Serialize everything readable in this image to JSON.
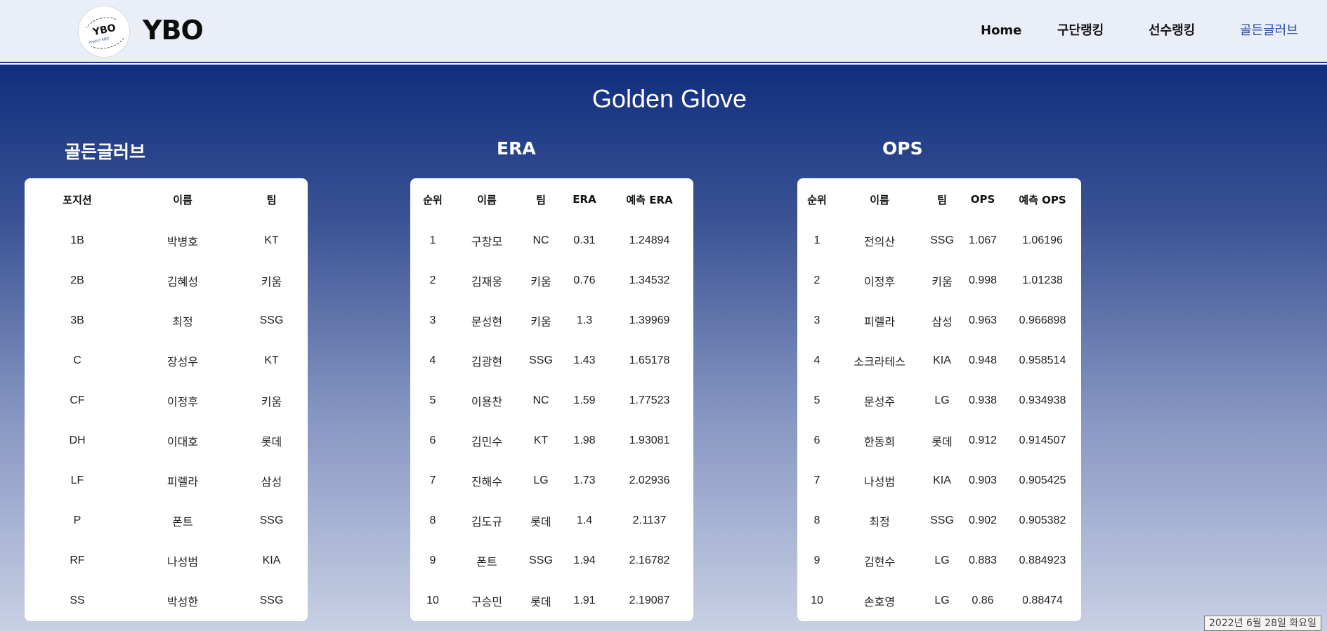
{
  "app": {
    "brand": "YBO",
    "logo_text": "YBO",
    "logo_subtext": "Predict KBO"
  },
  "nav": {
    "items": [
      {
        "label": "Home",
        "active": false
      },
      {
        "label": "구단랭킹",
        "active": false
      },
      {
        "label": "선수랭킹",
        "active": false
      },
      {
        "label": "골든글러브",
        "active": true
      }
    ]
  },
  "page": {
    "title": "Golden Glove"
  },
  "golden_glove": {
    "title": "골든글러브",
    "columns": [
      "포지션",
      "이름",
      "팀"
    ],
    "rows": [
      [
        "1B",
        "박병호",
        "KT"
      ],
      [
        "2B",
        "김혜성",
        "키움"
      ],
      [
        "3B",
        "최정",
        "SSG"
      ],
      [
        "C",
        "장성우",
        "KT"
      ],
      [
        "CF",
        "이정후",
        "키움"
      ],
      [
        "DH",
        "이대호",
        "롯데"
      ],
      [
        "LF",
        "피렐라",
        "삼성"
      ],
      [
        "P",
        "폰트",
        "SSG"
      ],
      [
        "RF",
        "나성범",
        "KIA"
      ],
      [
        "SS",
        "박성한",
        "SSG"
      ]
    ]
  },
  "era": {
    "title": "ERA",
    "columns": [
      "순위",
      "이름",
      "팀",
      "ERA",
      "예측 ERA"
    ],
    "rows": [
      [
        "1",
        "구창모",
        "NC",
        "0.31",
        "1.24894"
      ],
      [
        "2",
        "김재웅",
        "키움",
        "0.76",
        "1.34532"
      ],
      [
        "3",
        "문성현",
        "키움",
        "1.3",
        "1.39969"
      ],
      [
        "4",
        "김광현",
        "SSG",
        "1.43",
        "1.65178"
      ],
      [
        "5",
        "이용찬",
        "NC",
        "1.59",
        "1.77523"
      ],
      [
        "6",
        "김민수",
        "KT",
        "1.98",
        "1.93081"
      ],
      [
        "7",
        "진해수",
        "LG",
        "1.73",
        "2.02936"
      ],
      [
        "8",
        "김도규",
        "롯데",
        "1.4",
        "2.1137"
      ],
      [
        "9",
        "폰트",
        "SSG",
        "1.94",
        "2.16782"
      ],
      [
        "10",
        "구승민",
        "롯데",
        "1.91",
        "2.19087"
      ]
    ]
  },
  "ops": {
    "title": "OPS",
    "columns": [
      "순위",
      "이름",
      "팀",
      "OPS",
      "예측 OPS"
    ],
    "rows": [
      [
        "1",
        "전의산",
        "SSG",
        "1.067",
        "1.06196"
      ],
      [
        "2",
        "이정후",
        "키움",
        "0.998",
        "1.01238"
      ],
      [
        "3",
        "피렐라",
        "삼성",
        "0.963",
        "0.966898"
      ],
      [
        "4",
        "소크라테스",
        "KIA",
        "0.948",
        "0.958514"
      ],
      [
        "5",
        "문성주",
        "LG",
        "0.938",
        "0.934938"
      ],
      [
        "6",
        "한동희",
        "롯데",
        "0.912",
        "0.914507"
      ],
      [
        "7",
        "나성범",
        "KIA",
        "0.903",
        "0.905425"
      ],
      [
        "8",
        "최정",
        "SSG",
        "0.902",
        "0.905382"
      ],
      [
        "9",
        "김현수",
        "LG",
        "0.883",
        "0.884923"
      ],
      [
        "10",
        "손호영",
        "LG",
        "0.86",
        "0.88474"
      ]
    ]
  },
  "status": {
    "date": "2022년 6월 28일 화요일"
  },
  "colors": {
    "nav_bg": "#eaeef7",
    "active_link": "#2c53a8",
    "hero_top": "#102e7e",
    "hero_bottom": "#c8d0e4"
  }
}
